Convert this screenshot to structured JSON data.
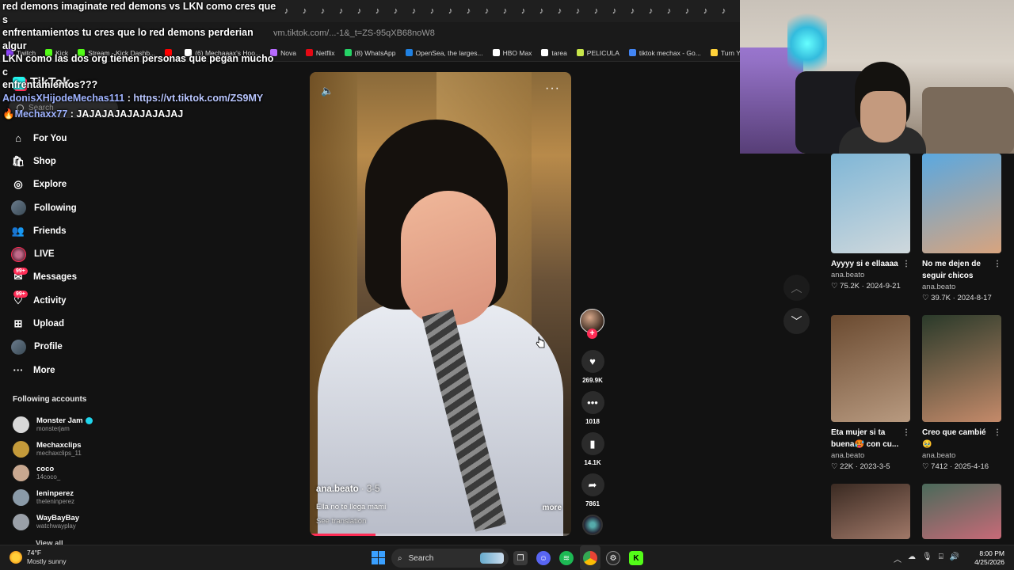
{
  "browser": {
    "url": "vm.tiktok.com/...-1&_t=ZS-95qXB68noW8",
    "tab_glyph": "♪",
    "bookmarks": [
      {
        "label": "Twitch",
        "color": "#9146ff"
      },
      {
        "label": "Kick",
        "color": "#53fc18"
      },
      {
        "label": "Stream - Kick Dashb...",
        "color": "#53fc18"
      },
      {
        "label": "",
        "color": "#ff0000"
      },
      {
        "label": "(6) Mechaaax's Hoo...",
        "color": "#ffffff"
      },
      {
        "label": "Nova",
        "color": "#b86bff"
      },
      {
        "label": "Netflix",
        "color": "#e50914"
      },
      {
        "label": "(8) WhatsApp",
        "color": "#25d366"
      },
      {
        "label": "OpenSea, the larges...",
        "color": "#2081e2"
      },
      {
        "label": "HBO Max",
        "color": "#ffffff"
      },
      {
        "label": "tarea",
        "color": "#ffffff"
      },
      {
        "label": "PELICULA",
        "color": "#c8e64a"
      },
      {
        "label": "tiktok mechax - Go...",
        "color": "#4285f4"
      },
      {
        "label": "Turn You",
        "color": "#ffd23a"
      }
    ]
  },
  "chat": {
    "message1": "red demons imaginate red demons vs LKN como cres que s\nenfrentamientos tu cres que lo red demons perderian algur\nLKN como las dos org tienen personas que pegan mucho c\nenfrentamientos???",
    "message2_user": "AdonisXHijodeMechas111",
    "message2_sep": " : ",
    "message2_link": "https://vt.tiktok.com/ZS9MY",
    "message3_user": "🔥Mechaxx77",
    "message3_text": " : JAJAJAJAJAJAJAJAJ"
  },
  "tiktok": {
    "logo": "TikTok",
    "search_placeholder": "Search",
    "nav": [
      {
        "label": "For You",
        "icon": "home-icon",
        "glyph": "⌂"
      },
      {
        "label": "Shop",
        "icon": "shop-icon",
        "glyph": "🛍"
      },
      {
        "label": "Explore",
        "icon": "compass-icon",
        "glyph": "◎"
      },
      {
        "label": "Following",
        "icon": "following-avatar",
        "glyph": ""
      },
      {
        "label": "Friends",
        "icon": "friends-icon",
        "glyph": "👥"
      },
      {
        "label": "LIVE",
        "icon": "live-icon",
        "glyph": ""
      },
      {
        "label": "Messages",
        "icon": "messages-icon",
        "glyph": "✉",
        "badge": "99+"
      },
      {
        "label": "Activity",
        "icon": "activity-icon",
        "glyph": "♡",
        "badge": "99+"
      },
      {
        "label": "Upload",
        "icon": "upload-icon",
        "glyph": "⊞"
      },
      {
        "label": "Profile",
        "icon": "profile-avatar",
        "glyph": ""
      },
      {
        "label": "More",
        "icon": "more-icon",
        "glyph": "···"
      }
    ],
    "following_heading": "Following accounts",
    "following": [
      {
        "name": "Monster Jam",
        "handle": "monsterjam",
        "verified": true,
        "color": "#d8d8d8"
      },
      {
        "name": "Mechaxclips",
        "handle": "mechaxclips_11",
        "verified": false,
        "color": "#c49a3a"
      },
      {
        "name": "coco",
        "handle": "14coco_",
        "verified": false,
        "color": "#c8a890"
      },
      {
        "name": "leninperez",
        "handle": "theleninperez",
        "verified": false,
        "color": "#8a9aa8"
      },
      {
        "name": "WayBayBay",
        "handle": "watchwayplay",
        "verified": false,
        "color": "#9aa0a8"
      }
    ],
    "view_all": "View all"
  },
  "video": {
    "author": "ana.beato",
    "date": " · 3-5",
    "caption": "Ella no te llega mami",
    "more": "more",
    "see_translation": "See translation",
    "progress": 0.25,
    "likes": "269.9K",
    "comments": "1018",
    "saves": "14.1K",
    "shares": "7861"
  },
  "recommendations": [
    {
      "title": "Ayyyy si e ellaaaa",
      "author": "ana.beato",
      "likes": "75.2K",
      "date": "2024-9-21",
      "c1": "#7fb6d6",
      "c2": "#cfd8dc"
    },
    {
      "title": "No me dejen de seguir chicos",
      "author": "ana.beato",
      "likes": "39.7K",
      "date": "2024-8-17",
      "c1": "#5aa8e0",
      "c2": "#d8a47e"
    },
    {
      "title": "Eta mujer si ta buena🥵 con cu...",
      "author": "ana.beato",
      "likes": "22K",
      "date": "2023-3-5",
      "c1": "#6a4a30",
      "c2": "#b89a80"
    },
    {
      "title": "Creo que cambié 🥹",
      "author": "ana.beato",
      "likes": "7412",
      "date": "2025-4-16",
      "c1": "#2a3a2a",
      "c2": "#c48a6a"
    },
    {
      "title": "",
      "author": "",
      "likes": "",
      "date": "",
      "c1": "#3a2a22",
      "c2": "#a07868"
    },
    {
      "title": "",
      "author": "",
      "likes": "",
      "date": "",
      "c1": "#4a6a5a",
      "c2": "#c86a78"
    }
  ],
  "taskbar": {
    "temp": "74°F",
    "weather": "Mostly sunny",
    "search": "Search",
    "time": "8:00 PM",
    "date": "4/25/2026"
  }
}
